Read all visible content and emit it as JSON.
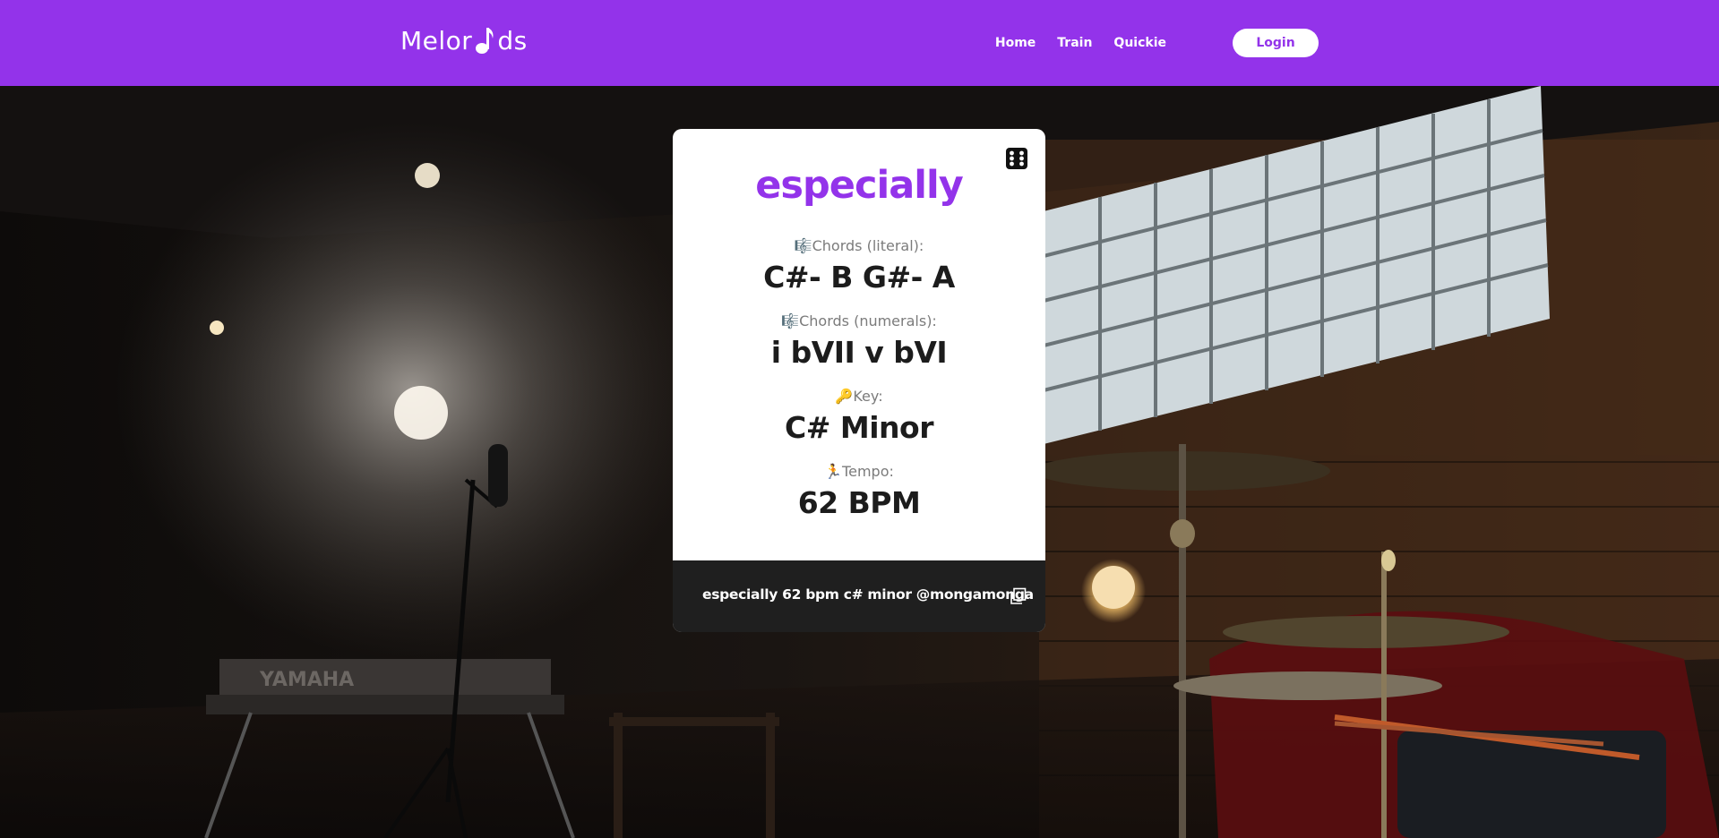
{
  "header": {
    "logo_text_left": "Melor",
    "logo_text_right": "ds",
    "logo_icon": "music-note-icon",
    "nav": [
      {
        "label": "Home"
      },
      {
        "label": "Train"
      },
      {
        "label": "Quickie"
      }
    ],
    "login_label": "Login",
    "brand_color": "#9333ea"
  },
  "card": {
    "shuffle_icon": "dice-icon",
    "title": "especially",
    "fields": [
      {
        "icon": "🎼",
        "label": "Chords (literal):",
        "value": "C#- B G#- A"
      },
      {
        "icon": "🎼",
        "label": "Chords (numerals):",
        "value": "i bVII v bVI"
      },
      {
        "icon": "🔑",
        "label": "Key:",
        "value": "C# Minor"
      },
      {
        "icon": "🏃",
        "label": "Tempo:",
        "value": "62 BPM"
      }
    ],
    "share_text": "especially 62 bpm c# minor @mongamonga",
    "copy_icon": "copy-icon"
  },
  "background": {
    "description_icon": "music-venue-photo",
    "keyboard_brand": "YAMAHA"
  }
}
